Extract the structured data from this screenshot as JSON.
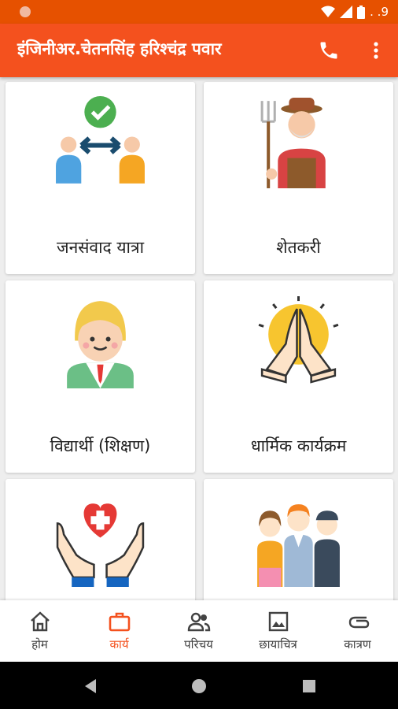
{
  "status_bar": {
    "time_partial": ". .9"
  },
  "app_bar": {
    "title": "इंजिनीअर.चेतनसिंह हरिश्चंद्र पवार",
    "phone_icon": "phone-icon",
    "more_icon": "more-vert-icon"
  },
  "cards": [
    {
      "label": "जनसंवाद यात्रा",
      "icon": "people-exchange-icon"
    },
    {
      "label": "शेतकरी",
      "icon": "farmer-icon"
    },
    {
      "label": "विद्यार्थी (शिक्षण)",
      "icon": "student-icon"
    },
    {
      "label": "धार्मिक कार्यक्रम",
      "icon": "praying-hands-icon"
    },
    {
      "label": "",
      "icon": "health-care-hands-icon"
    },
    {
      "label": "",
      "icon": "people-group-icon"
    }
  ],
  "bottom_nav": [
    {
      "label": "होम",
      "icon": "home-icon",
      "active": false
    },
    {
      "label": "कार्य",
      "icon": "briefcase-icon",
      "active": true
    },
    {
      "label": "परिचय",
      "icon": "people-icon",
      "active": false
    },
    {
      "label": "छायाचित्र",
      "icon": "image-icon",
      "active": false
    },
    {
      "label": "कात्रण",
      "icon": "paperclip-icon",
      "active": false
    }
  ],
  "colors": {
    "primary": "#f4511e",
    "status_bar": "#e65100",
    "active_nav": "#f4511e"
  }
}
